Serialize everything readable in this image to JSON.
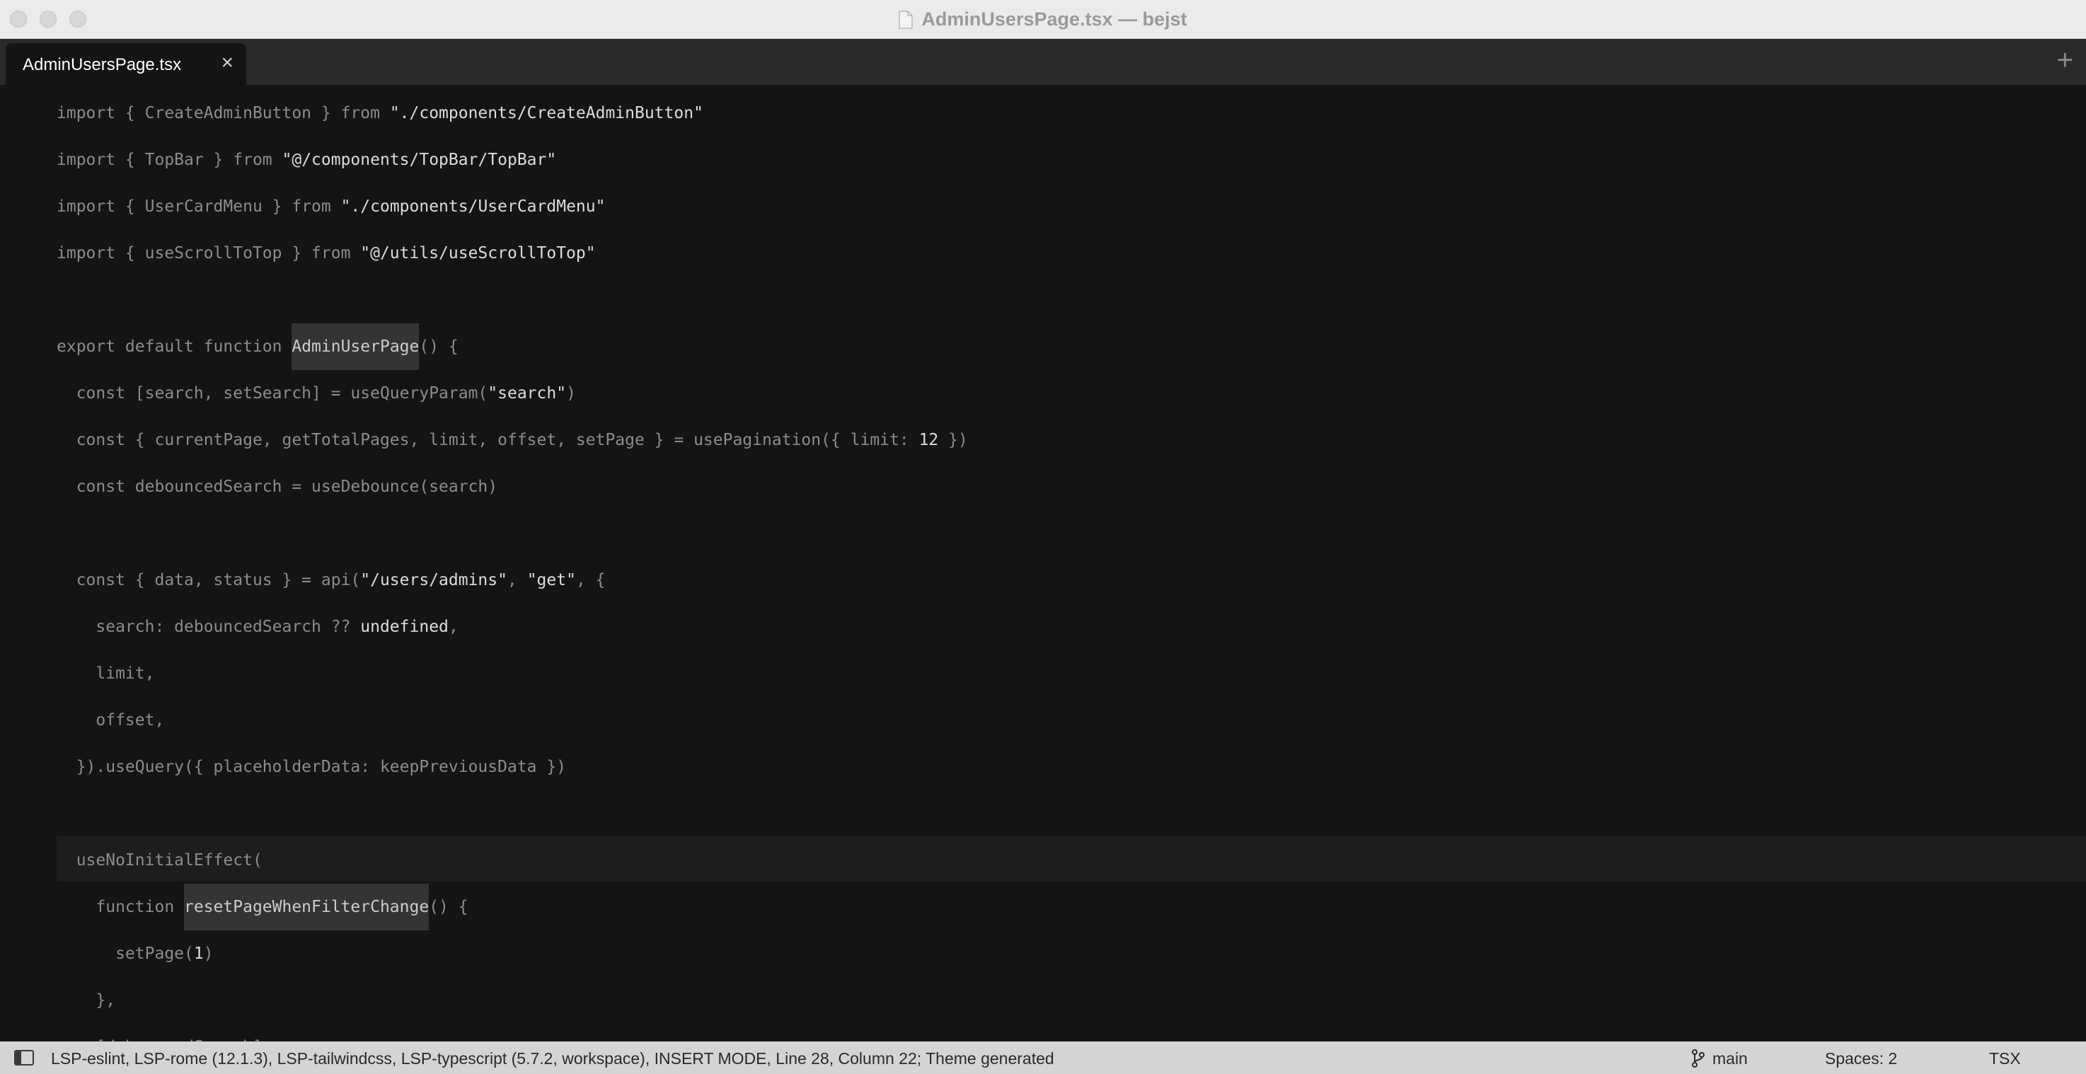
{
  "window": {
    "title": "AdminUsersPage.tsx — bejst"
  },
  "tabs": [
    {
      "label": "AdminUsersPage.tsx",
      "close_glyph": "×",
      "active": true
    }
  ],
  "tabbar": {
    "add_glyph": "+"
  },
  "editor": {
    "lines": [
      [
        {
          "t": "import { CreateAdminButton } from "
        },
        {
          "t": "\"./components/CreateAdminButton\"",
          "c": "s"
        }
      ],
      [
        {
          "t": "import { TopBar } from "
        },
        {
          "t": "\"@/components/TopBar/TopBar\"",
          "c": "s"
        }
      ],
      [
        {
          "t": "import { UserCardMenu } from "
        },
        {
          "t": "\"./components/UserCardMenu\"",
          "c": "s"
        }
      ],
      [
        {
          "t": "import { useScrollToTop } from "
        },
        {
          "t": "\"@/utils/useScrollToTop\"",
          "c": "s"
        }
      ],
      [],
      [
        {
          "t": "export default function "
        },
        {
          "t": "AdminUserPage",
          "c": "hl"
        },
        {
          "t": "() {"
        }
      ],
      [
        {
          "t": "  const [search, setSearch] = useQueryParam("
        },
        {
          "t": "\"search\"",
          "c": "s"
        },
        {
          "t": ")"
        }
      ],
      [
        {
          "t": "  const { currentPage, getTotalPages, limit, offset, setPage } = usePagination({ limit: "
        },
        {
          "t": "12",
          "c": "s"
        },
        {
          "t": " })"
        }
      ],
      [
        {
          "t": "  const debouncedSearch = useDebounce(search)"
        }
      ],
      [],
      [
        {
          "t": "  const { data, status } = api("
        },
        {
          "t": "\"/users/admins\"",
          "c": "s"
        },
        {
          "t": ", "
        },
        {
          "t": "\"get\"",
          "c": "s"
        },
        {
          "t": ", {"
        }
      ],
      [
        {
          "t": "    search: debouncedSearch ?? "
        },
        {
          "t": "undefined",
          "c": "s"
        },
        {
          "t": ","
        }
      ],
      [
        {
          "t": "    limit,"
        }
      ],
      [
        {
          "t": "    offset,"
        }
      ],
      [
        {
          "t": "  }).useQuery({ placeholderData: keepPreviousData })"
        }
      ],
      [],
      [
        {
          "t": "  useNoInitialEffect("
        }
      ],
      [
        {
          "t": "    function "
        },
        {
          "t": "resetPageWhenFilterChange",
          "c": "hl"
        },
        {
          "t": "() {"
        }
      ],
      [
        {
          "t": "      setPage("
        },
        {
          "t": "1",
          "c": "s"
        },
        {
          "t": ")"
        }
      ],
      [
        {
          "t": "    },"
        }
      ],
      [
        {
          "t": "    [debouncedSearch]"
        }
      ]
    ]
  },
  "statusbar": {
    "message": "LSP-eslint, LSP-rome (12.1.3), LSP-tailwindcss, LSP-typescript (5.7.2, workspace), INSERT MODE, Line 28, Column 22; Theme generated",
    "branch": "main",
    "spaces": "Spaces: 2",
    "language": "TSX"
  }
}
